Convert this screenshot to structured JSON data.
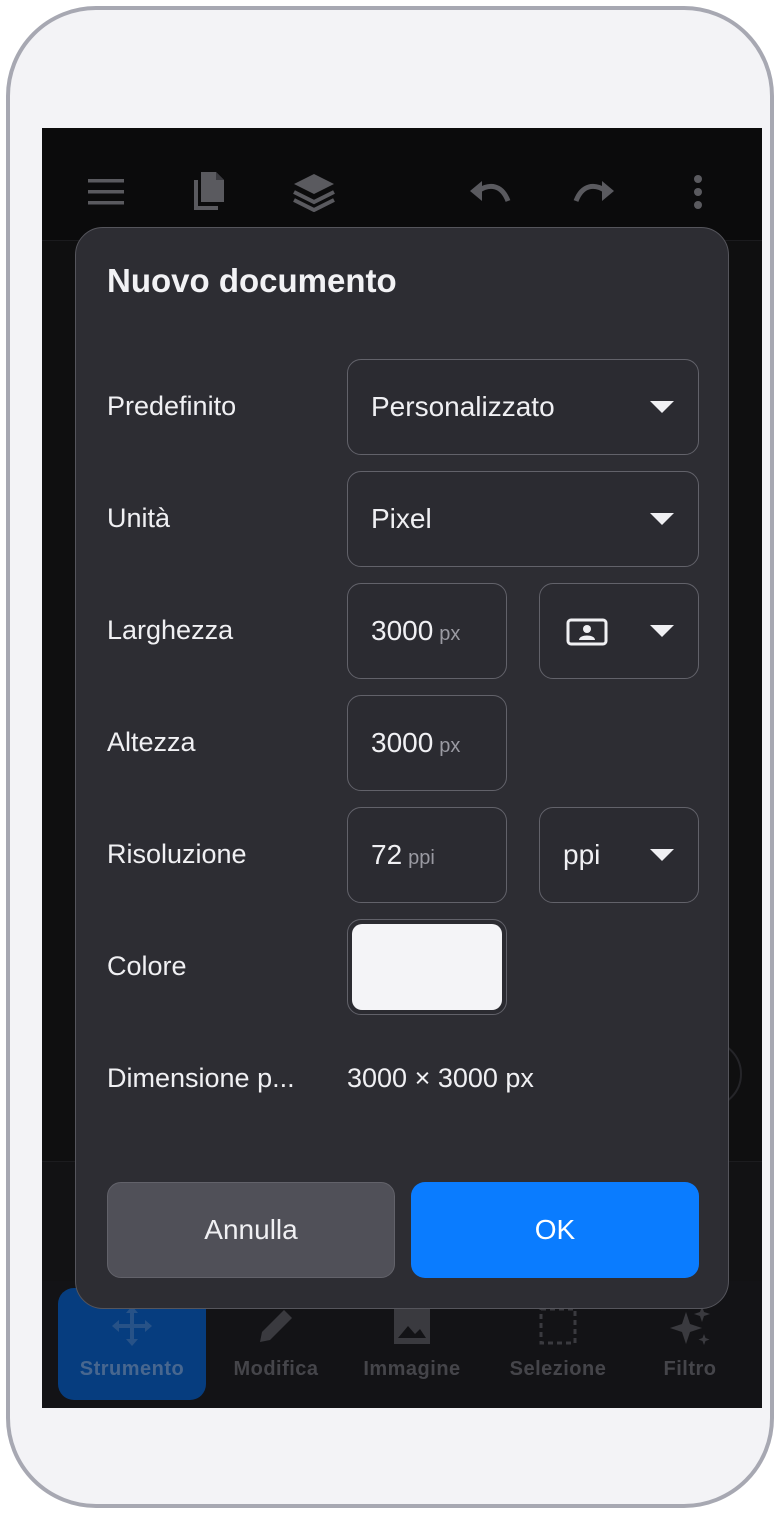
{
  "toolbar": {
    "icons": [
      "menu-icon",
      "documents-icon",
      "layers-icon",
      "undo-icon",
      "redo-icon",
      "more-vertical-icon"
    ]
  },
  "bottom_nav": {
    "items": [
      {
        "label": "Strumento",
        "icon": "move-icon",
        "active": true
      },
      {
        "label": "Modifica",
        "icon": "pencil-icon",
        "active": false
      },
      {
        "label": "Immagine",
        "icon": "image-icon",
        "active": false
      },
      {
        "label": "Selezione",
        "icon": "selection-icon",
        "active": false
      },
      {
        "label": "Filtro",
        "icon": "sparkle-icon",
        "active": false
      }
    ]
  },
  "dialog": {
    "title": "Nuovo documento",
    "preset": {
      "label": "Predefinito",
      "value": "Personalizzato"
    },
    "units": {
      "label": "Unità",
      "value": "Pixel"
    },
    "width": {
      "label": "Larghezza",
      "value": "3000",
      "unit": "px",
      "orientation_icon": "portrait-orientation-icon"
    },
    "height": {
      "label": "Altezza",
      "value": "3000",
      "unit": "px"
    },
    "resolution": {
      "label": "Risoluzione",
      "value": "72",
      "unit": "ppi",
      "unit_select": "ppi"
    },
    "color": {
      "label": "Colore",
      "value": "#F4F4F7"
    },
    "dimensions": {
      "label": "Dimensione p...",
      "value": "3000 × 3000 px"
    },
    "cancel_label": "Annulla",
    "ok_label": "OK"
  },
  "colors": {
    "accent": "#0A7CFF",
    "dialog_bg": "#2D2D33",
    "active_nav": "#0A5FC4"
  }
}
